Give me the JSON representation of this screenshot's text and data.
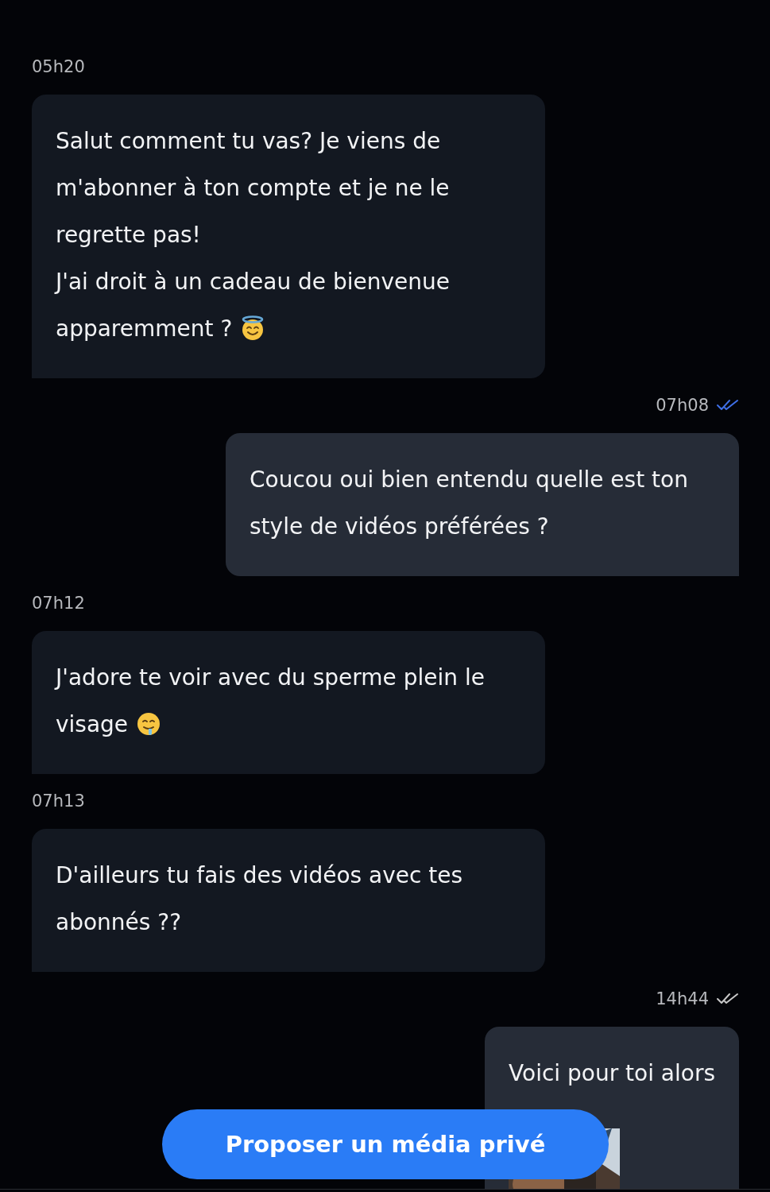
{
  "messages": [
    {
      "kind": "incoming",
      "time": "05h20",
      "text": "Salut comment tu vas? Je viens de m'abonner à ton compte et je ne le regrette pas!\nJ'ai droit à un cadeau de bienvenue apparemment ?",
      "emoji": {
        "kind": "halo-face"
      }
    },
    {
      "kind": "outgoing",
      "time": "07h08",
      "read": true,
      "text": "Coucou oui bien entendu quelle est ton style de vidéos préférées ?"
    },
    {
      "kind": "incoming",
      "time": "07h12",
      "text": "J'adore te voir avec du sperme plein le visage",
      "emoji": {
        "kind": "drooling-face"
      }
    },
    {
      "kind": "incoming",
      "time": "07h13",
      "text": "D'ailleurs tu fais des vidéos avec tes abonnés ??"
    },
    {
      "kind": "outgoing",
      "time": "14h44",
      "read": false,
      "text": "Voici pour toi alors"
    }
  ],
  "action_button": {
    "label": "Proposer un média privé"
  }
}
